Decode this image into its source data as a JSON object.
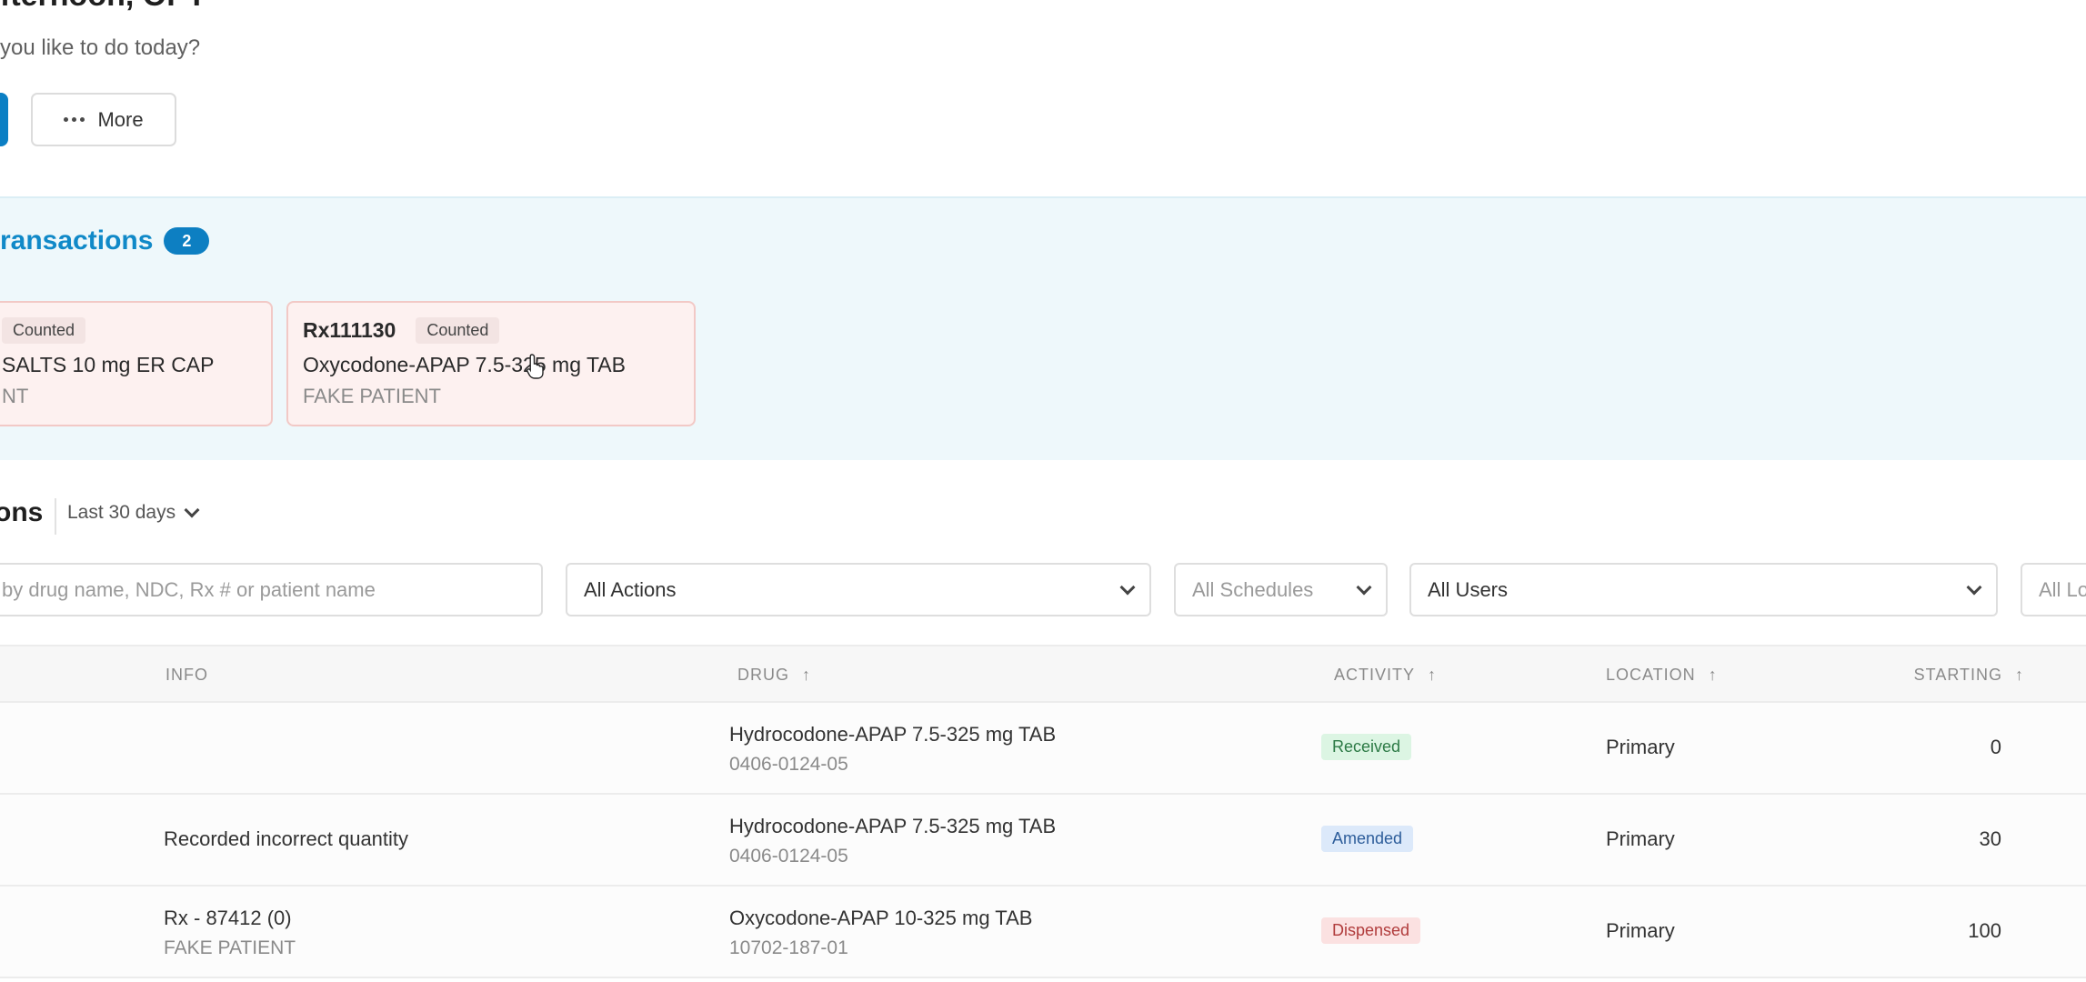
{
  "header": {
    "greeting": "fternoon, OPT",
    "subtitle": "you like to do today?",
    "more_label": "More"
  },
  "pending": {
    "title": "ransactions",
    "count": "2",
    "cards": [
      {
        "rx": "",
        "status": "Counted",
        "drug": "SALTS 10 mg ER CAP",
        "patient": "NT"
      },
      {
        "rx": "Rx111130",
        "status": "Counted",
        "drug": "Oxycodone-APAP 7.5-325 mg TAB",
        "patient": "FAKE PATIENT"
      }
    ]
  },
  "recent": {
    "title": "ons",
    "range": "Last 30 days"
  },
  "filters": {
    "search_placeholder": "by drug name, NDC, Rx # or patient name",
    "actions": "All Actions",
    "schedules": "All Schedules",
    "users": "All Users",
    "locations": "All Lo"
  },
  "table": {
    "headers": {
      "info": "INFO",
      "drug": "DRUG",
      "activity": "ACTIVITY",
      "location": "LOCATION",
      "starting": "STARTING"
    },
    "rows": [
      {
        "info": "",
        "info_sub": "",
        "drug": "Hydrocodone-APAP 7.5-325 mg TAB",
        "ndc": "0406-0124-05",
        "activity": "Received",
        "location": "Primary",
        "starting": "0"
      },
      {
        "info": "Recorded incorrect quantity",
        "info_sub": "",
        "drug": "Hydrocodone-APAP 7.5-325 mg TAB",
        "ndc": "0406-0124-05",
        "activity": "Amended",
        "location": "Primary",
        "starting": "30"
      },
      {
        "info": "Rx - 87412 (0)",
        "info_sub": "FAKE PATIENT",
        "drug": "Oxycodone-APAP 10-325 mg TAB",
        "ndc": "10702-187-01",
        "activity": "Dispensed",
        "location": "Primary",
        "starting": "100"
      }
    ]
  },
  "colors": {
    "accent": "#0b7fc4",
    "panel_bg": "#eef8fb",
    "card_bg": "#fdf1f0"
  }
}
